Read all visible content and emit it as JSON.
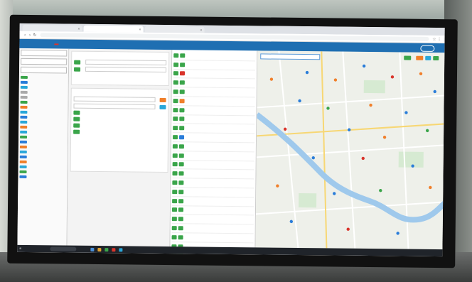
{
  "browser": {
    "tabs": [
      {
        "label": "",
        "active": false
      },
      {
        "label": "",
        "active": true
      },
      {
        "label": "",
        "active": false
      }
    ],
    "url": ""
  },
  "app": {
    "nav": [
      {
        "label": "",
        "active": false
      },
      {
        "label": "",
        "active": false
      },
      {
        "label": "",
        "active": true
      },
      {
        "label": "",
        "active": false
      },
      {
        "label": "",
        "active": false
      },
      {
        "label": "",
        "active": false
      }
    ]
  },
  "colors": {
    "header_blue": "#1f6fb2",
    "accent_red": "#d9342b",
    "green": "#3aa54a",
    "orange": "#f07f2a",
    "light_blue": "#2aa7d9",
    "map_water": "#9fc9ec",
    "map_land": "#eef0ea"
  },
  "icons": [
    "back-icon",
    "forward-icon",
    "reload-icon",
    "star-icon",
    "menu-icon",
    "search-icon",
    "pin-icon",
    "windows-icon"
  ]
}
